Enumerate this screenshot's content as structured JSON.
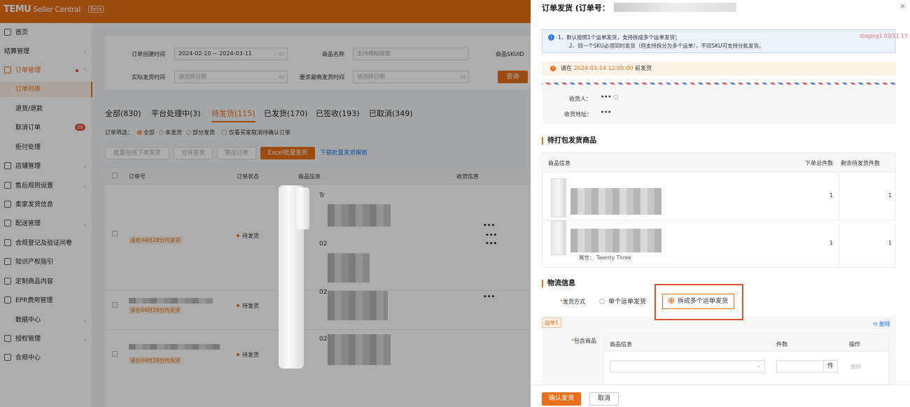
{
  "header": {
    "logo": "TEMU",
    "brand_suffix": "Seller Central",
    "beta": "Beta"
  },
  "sidebar": {
    "items": [
      {
        "label": "首页",
        "chev": ""
      },
      {
        "label": "结算管理",
        "chev": "⌄"
      },
      {
        "label": "订单管理",
        "chev": "⌃"
      },
      {
        "label": "订单列表",
        "chev": ""
      },
      {
        "label": "退货/退款",
        "chev": ""
      },
      {
        "label": "取消订单",
        "badge": "28"
      },
      {
        "label": "拒付处理",
        "chev": ""
      },
      {
        "label": "店铺管理",
        "chev": "⌄"
      },
      {
        "label": "售后规则设置",
        "chev": "⌄"
      },
      {
        "label": "卖家发货信息",
        "chev": ""
      },
      {
        "label": "配送管理",
        "chev": "⌄"
      },
      {
        "label": "合规登记及验证问卷",
        "chev": ""
      },
      {
        "label": "知识产权指引",
        "chev": ""
      },
      {
        "label": "定制商品内容",
        "chev": ""
      },
      {
        "label": "EPR费用管理",
        "chev": ""
      },
      {
        "label": "数据中心",
        "chev": "⌄"
      },
      {
        "label": "授权管理",
        "chev": "⌄"
      },
      {
        "label": "合规中心",
        "chev": ""
      }
    ]
  },
  "filters": {
    "created_label": "订单创建时间",
    "created_value": "2024-02-10 ~ 2024-03-11",
    "product_label": "商品名称",
    "product_ph": "支持模糊搜索",
    "skuid_label": "商品SKUID",
    "actual_label": "实际发货时间",
    "actual_ph": "请选择日期",
    "latest_label": "要求最晚发货时间",
    "latest_ph": "请选择日期",
    "query_btn": "查询",
    "cal": "▭"
  },
  "tabs": [
    "全部(830)",
    "平台处理中(3)",
    "待发货(115)",
    "已发货(170)",
    "已签收(193)",
    "已取消(349)"
  ],
  "order_filter": {
    "label": "订单筛选：",
    "all": "全部",
    "unshipped": "未发货",
    "partial": "部分发货",
    "only_cancel": "仅看买家取消待确认订单"
  },
  "actions": {
    "batch_online": "批量在线下单发货",
    "merge": "合并发货",
    "export": "导出订单",
    "excel": "Excel批量发货",
    "template": "下载批量发货模板"
  },
  "table": {
    "headers": {
      "order_no": "订单号",
      "status": "订单状态",
      "product": "商品信息",
      "receive": "收货信息"
    },
    "rows": [
      {
        "deadline": "请在44时28分内发货",
        "status": "待发货",
        "items": [
          "Tr",
          "02"
        ]
      },
      {
        "deadline": "请在44时28分内发货",
        "status": "待发货",
        "items": [
          "02"
        ]
      },
      {
        "deadline": "请在44时28分内发货",
        "status": "待发货",
        "items": [
          "02"
        ]
      }
    ],
    "dots": "•••"
  },
  "drawer": {
    "title": "订单发货 (订单号：",
    "close": "×",
    "info_line1": "1、默认按照1个运单发货，支持拆成多个运单发货；",
    "info_line2": "2、同一个SKU必须同时发货（但支持拆分为多个运单），不同SKU可支持分批发货。",
    "staging": "staging1 03/11 17:",
    "warn_pre": "请在 ",
    "warn_date": "2024-03-14 12:05:00",
    "warn_post": " 前发货",
    "consignee_label": "收货人：",
    "consignee_value": "••• ◌",
    "address_label": "收货地址：",
    "address_value": "•••",
    "pack_section": "待打包发货商品",
    "pack_headers": {
      "info": "商品信息",
      "total": "下单总件数",
      "remain": "剩余待发货件数"
    },
    "pack_rows": [
      {
        "total": "1",
        "remain": "1",
        "attr": ""
      },
      {
        "total": "1",
        "remain": "1",
        "attr": "属性： Twenty Three"
      }
    ],
    "logistics_section": "物流信息",
    "ship_method_label": "发货方式",
    "opt_single": "单个运单发货",
    "opt_split": "拆成多个运单发货",
    "waybill_tag": "运单1",
    "waybill_delete": "⟲ 删除",
    "includes_label": "包含商品",
    "wb_headers": {
      "info": "商品信息",
      "qty": "件数",
      "op": "操作"
    },
    "unit": "件",
    "row_delete": "删除",
    "confirm": "确认发货",
    "cancel": "取消"
  },
  "colors": {
    "accent": "#e8701a",
    "link": "#1a73e8",
    "danger": "#e34d3c"
  }
}
